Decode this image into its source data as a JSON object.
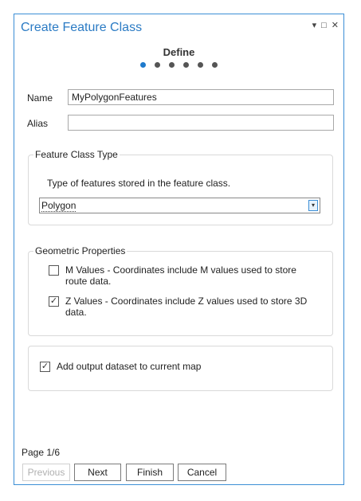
{
  "pane": {
    "title": "Create Feature Class",
    "buttons": {
      "dropdown": "▾",
      "maximize": "□",
      "close": "✕"
    }
  },
  "wizard": {
    "step_title": "Define",
    "current_step": 1,
    "total_steps": 6,
    "page_indicator": "Page 1/6"
  },
  "fields": {
    "name_label": "Name",
    "name_value": "MyPolygonFeatures",
    "alias_label": "Alias",
    "alias_value": ""
  },
  "feature_class_type": {
    "legend": "Feature Class Type",
    "description": "Type of features stored in the feature class.",
    "selected": "Polygon"
  },
  "geometric_properties": {
    "legend": "Geometric Properties",
    "m_values": {
      "label": "M Values - Coordinates include M values used to store route data.",
      "checked": false
    },
    "z_values": {
      "label": "Z Values - Coordinates include Z values used to store 3D data.",
      "checked": true
    }
  },
  "output": {
    "add_to_map": {
      "label": "Add output dataset to current map",
      "checked": true
    }
  },
  "footer": {
    "previous": "Previous",
    "next": "Next",
    "finish": "Finish",
    "cancel": "Cancel"
  },
  "colors": {
    "accent": "#2b7bc4",
    "active_dot": "#1f7acc",
    "inactive_dot": "#555555"
  }
}
